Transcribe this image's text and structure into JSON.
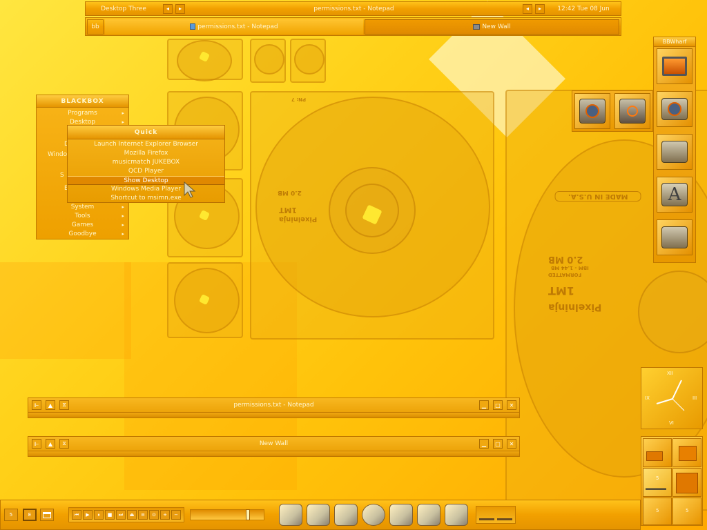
{
  "toolbar": {
    "workspace_name": "Desktop Three",
    "window_title": "permissions.txt - Notepad",
    "clock": "12:42 Tue 08 Jun",
    "prev_icon": "left-arrow-icon",
    "next_icon": "right-arrow-icon"
  },
  "taskbar": {
    "label": "bb",
    "tasks": [
      {
        "label": "permissions.txt - Notepad",
        "icon": "notepad-icon"
      },
      {
        "label": "New Wall",
        "icon": "wallpaper-icon"
      }
    ]
  },
  "root_menu": {
    "title": "BLACKBOX",
    "items": [
      {
        "label": "Programs"
      },
      {
        "label": "Desktop"
      },
      {
        "label": "System"
      },
      {
        "label": "Tools"
      },
      {
        "label": "Games"
      },
      {
        "label": "Goodbye"
      }
    ],
    "partial_labels": [
      "D",
      "Windo",
      "S",
      "E"
    ]
  },
  "quick_menu": {
    "title": "Quick",
    "items": [
      {
        "label": "Launch Internet Explorer Browser"
      },
      {
        "label": "Mozilla Firefox"
      },
      {
        "label": "musicmatch JUKEBOX"
      },
      {
        "label": "QCD Player"
      },
      {
        "label": "Show Desktop",
        "selected": true
      },
      {
        "label": "Windows Media Player"
      },
      {
        "label": "Shortcut to msimn.exe"
      }
    ]
  },
  "slit": {
    "title": "BBWharf",
    "icons": [
      "monitor-icon",
      "power-folder-icon",
      "calculator-folder-icon",
      "font-folder-icon",
      "trumpet-folder-icon"
    ]
  },
  "slit_extra_icons": [
    "power-tile-icon",
    "settings-tile-icon"
  ],
  "windows": [
    {
      "title": "permissions.txt - Notepad"
    },
    {
      "title": "New Wall"
    }
  ],
  "clock_widget": {
    "numerals": [
      "XII",
      "III",
      "VI",
      "IX"
    ]
  },
  "pager": {
    "labels": [
      "5",
      "5",
      "5"
    ]
  },
  "bottom_bar": {
    "left_buttons": [
      "5",
      "E"
    ],
    "media_controls": [
      "prev-icon",
      "play-icon",
      "pause-icon",
      "stop-icon",
      "next-icon",
      "eject-icon",
      "playlist-icon",
      "repeat-icon",
      "volume-up-icon",
      "volume-down-icon"
    ],
    "dock_icons": [
      "drives-icon",
      "harddisk-icon",
      "wrench-icon",
      "film-reel-icon",
      "folder-icon",
      "cd-drive-icon",
      "documents-icon"
    ],
    "tray_icons": [
      "grass-icon",
      "dog-icon"
    ]
  },
  "floppy_text": {
    "brand": "Pixelninja",
    "model": "1MT",
    "capacity": "2.0 MB",
    "formatted": "FORMATTED",
    "spec": "IBM - 1.44 MB",
    "made_in": "MADE IN U.S.A.",
    "partno": "PN: 7"
  },
  "colors": {
    "accent": "#f2a000",
    "background": "#ffd21a",
    "text": "#fff6d0"
  }
}
